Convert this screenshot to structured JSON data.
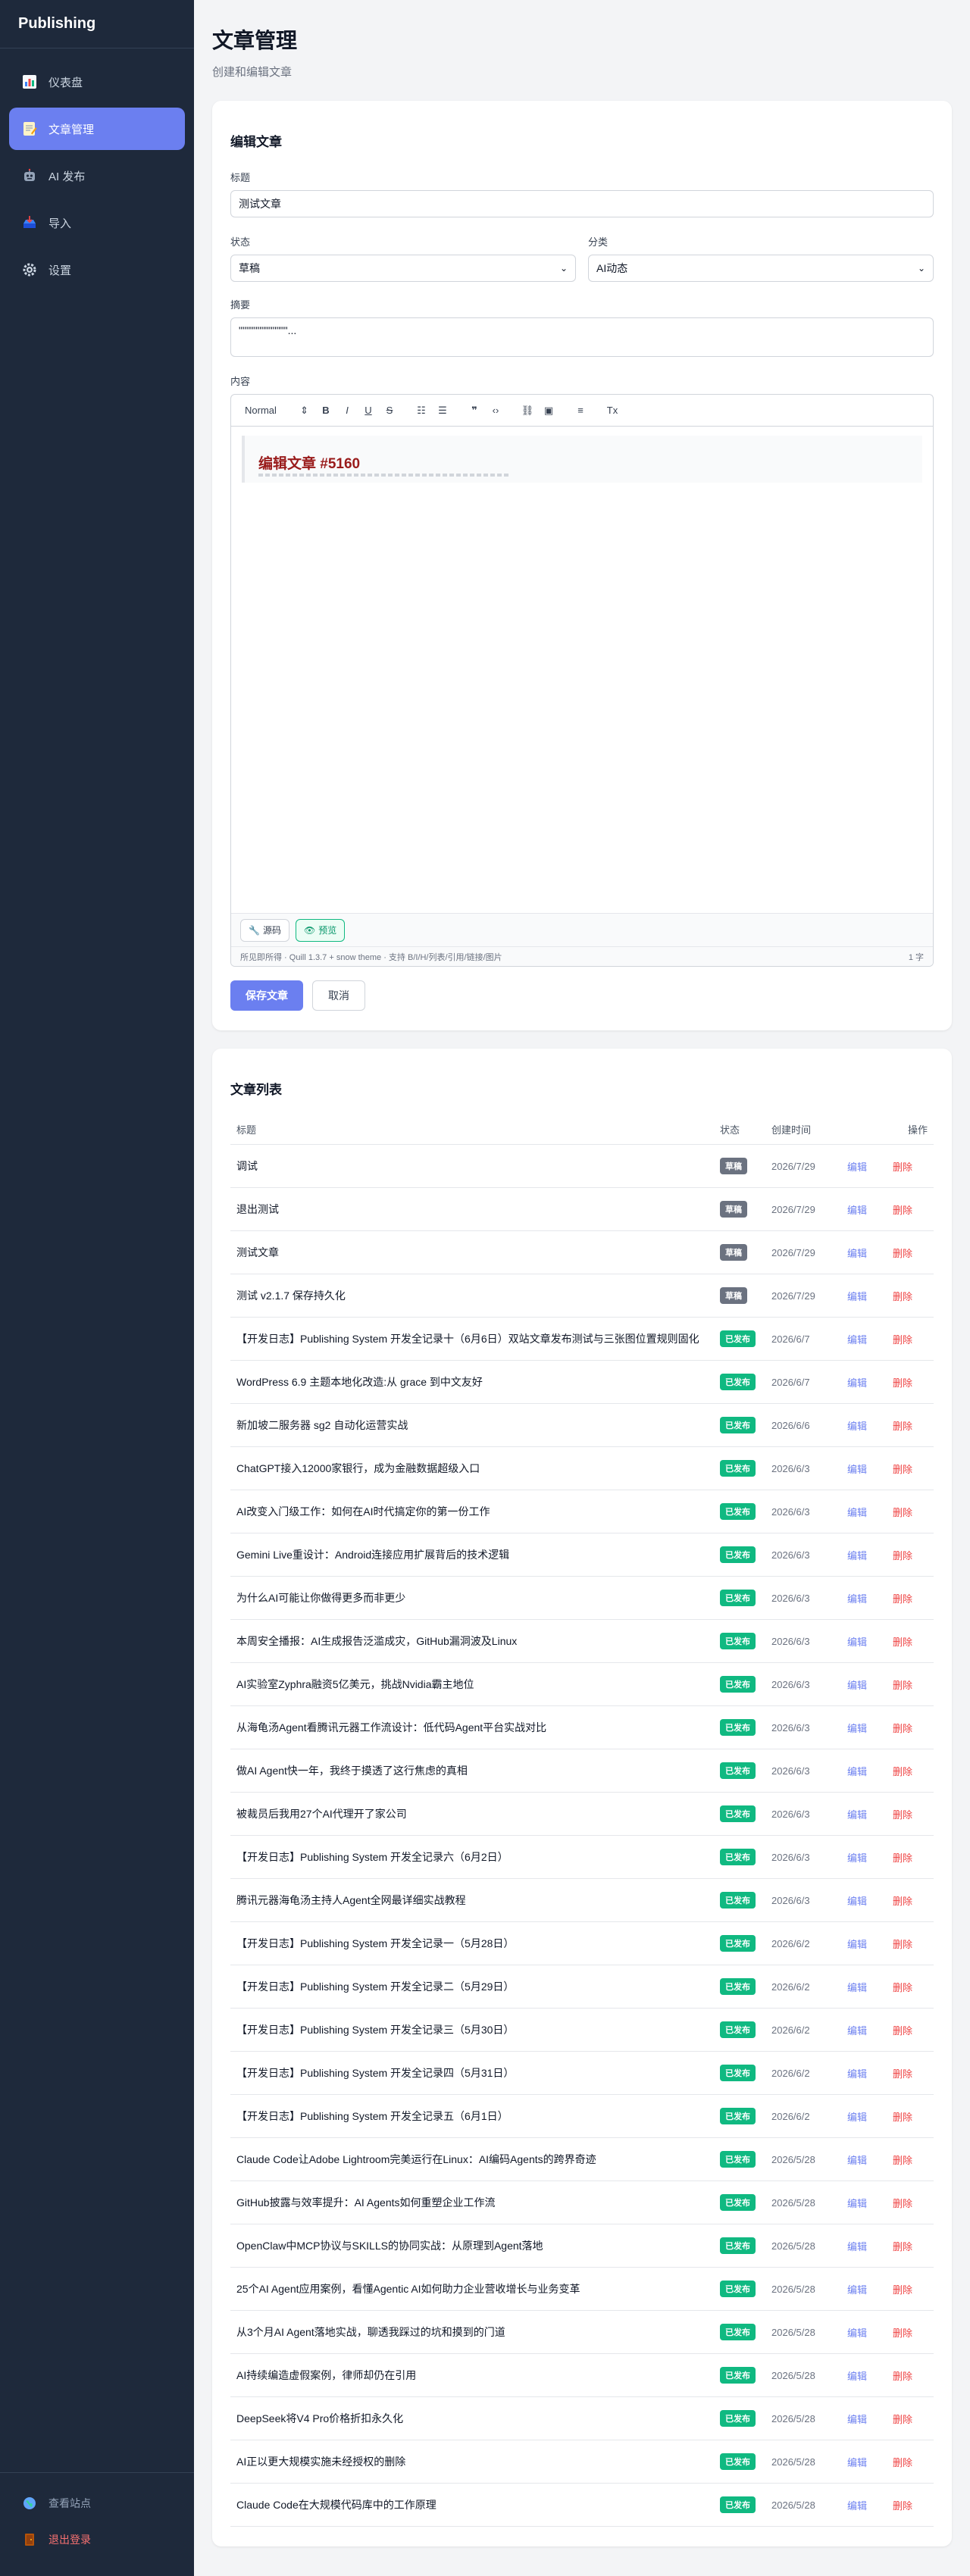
{
  "app": {
    "brand": "Publishing"
  },
  "sidebar": {
    "items": [
      {
        "label": "仪表盘",
        "icon": "bar-chart-icon"
      },
      {
        "label": "文章管理",
        "icon": "memo-icon"
      },
      {
        "label": "AI 发布",
        "icon": "robot-icon"
      },
      {
        "label": "导入",
        "icon": "inbox-icon"
      },
      {
        "label": "设置",
        "icon": "gear-icon"
      }
    ],
    "active": "文章管理",
    "footer": {
      "view_site": "查看站点",
      "logout": "退出登录"
    }
  },
  "header": {
    "title": "文章管理",
    "subtitle": "创建和编辑文章"
  },
  "editor": {
    "card_title": "编辑文章",
    "title_label": "标题",
    "title_value": "测试文章",
    "status_label": "状态",
    "status_value": "草稿",
    "category_label": "分类",
    "category_value": "AI动态",
    "summary_label": "摘要",
    "summary_value": "\"\"\"\"\"\"\"\"\"\"\"\"\"...",
    "content_label": "内容",
    "toolbar_format": "Normal",
    "preview_title": "编辑文章 #5160",
    "source_button": "源码",
    "preview_button": "预览",
    "status_info": "所见即所得 · Quill 1.3.7 + snow theme · 支持 B/I/H/列表/引用/链接/图片",
    "char_count": "1 字",
    "save_button": "保存文章",
    "cancel_button": "取消"
  },
  "articles": {
    "card_title": "文章列表",
    "columns": {
      "title": "标题",
      "status": "状态",
      "created": "创建时间",
      "actions": "操作"
    },
    "edit_label": "编辑",
    "delete_label": "删除",
    "rows": [
      {
        "title": "调试",
        "status": "草稿",
        "date": "2026/7/29"
      },
      {
        "title": "退出测试",
        "status": "草稿",
        "date": "2026/7/29"
      },
      {
        "title": "测试文章",
        "status": "草稿",
        "date": "2026/7/29"
      },
      {
        "title": "测试 v2.1.7 保存持久化",
        "status": "草稿",
        "date": "2026/7/29"
      },
      {
        "title": "【开发日志】Publishing System 开发全记录十（6月6日）双站文章发布测试与三张图位置规则固化",
        "status": "已发布",
        "date": "2026/6/7"
      },
      {
        "title": "WordPress 6.9 主题本地化改造:从 grace 到中文友好",
        "status": "已发布",
        "date": "2026/6/7"
      },
      {
        "title": "新加坡二服务器 sg2 自动化运营实战",
        "status": "已发布",
        "date": "2026/6/6"
      },
      {
        "title": "ChatGPT接入12000家银行，成为金融数据超级入口",
        "status": "已发布",
        "date": "2026/6/3"
      },
      {
        "title": "AI改变入门级工作：如何在AI时代搞定你的第一份工作",
        "status": "已发布",
        "date": "2026/6/3"
      },
      {
        "title": "Gemini Live重设计：Android连接应用扩展背后的技术逻辑",
        "status": "已发布",
        "date": "2026/6/3"
      },
      {
        "title": "为什么AI可能让你做得更多而非更少",
        "status": "已发布",
        "date": "2026/6/3"
      },
      {
        "title": "本周安全播报：AI生成报告泛滥成灾，GitHub漏洞波及Linux",
        "status": "已发布",
        "date": "2026/6/3"
      },
      {
        "title": "AI实验室Zyphra融资5亿美元，挑战Nvidia霸主地位",
        "status": "已发布",
        "date": "2026/6/3"
      },
      {
        "title": "从海龟汤Agent看腾讯元器工作流设计：低代码Agent平台实战对比",
        "status": "已发布",
        "date": "2026/6/3"
      },
      {
        "title": "做AI Agent快一年，我终于摸透了这行焦虑的真相",
        "status": "已发布",
        "date": "2026/6/3"
      },
      {
        "title": "被裁员后我用27个AI代理开了家公司",
        "status": "已发布",
        "date": "2026/6/3"
      },
      {
        "title": "【开发日志】Publishing System 开发全记录六（6月2日）",
        "status": "已发布",
        "date": "2026/6/3"
      },
      {
        "title": "腾讯元器海龟汤主持人Agent全网最详细实战教程",
        "status": "已发布",
        "date": "2026/6/3"
      },
      {
        "title": "【开发日志】Publishing System 开发全记录一（5月28日）",
        "status": "已发布",
        "date": "2026/6/2"
      },
      {
        "title": "【开发日志】Publishing System 开发全记录二（5月29日）",
        "status": "已发布",
        "date": "2026/6/2"
      },
      {
        "title": "【开发日志】Publishing System 开发全记录三（5月30日）",
        "status": "已发布",
        "date": "2026/6/2"
      },
      {
        "title": "【开发日志】Publishing System 开发全记录四（5月31日）",
        "status": "已发布",
        "date": "2026/6/2"
      },
      {
        "title": "【开发日志】Publishing System 开发全记录五（6月1日）",
        "status": "已发布",
        "date": "2026/6/2"
      },
      {
        "title": "Claude Code让Adobe Lightroom完美运行在Linux：AI编码Agents的跨界奇迹",
        "status": "已发布",
        "date": "2026/5/28"
      },
      {
        "title": "GitHub披露与效率提升：AI Agents如何重塑企业工作流",
        "status": "已发布",
        "date": "2026/5/28"
      },
      {
        "title": "OpenClaw中MCP协议与SKILLS的协同实战：从原理到Agent落地",
        "status": "已发布",
        "date": "2026/5/28"
      },
      {
        "title": "25个AI Agent应用案例，看懂Agentic AI如何助力企业营收增长与业务变革",
        "status": "已发布",
        "date": "2026/5/28"
      },
      {
        "title": "从3个月AI Agent落地实战，聊透我踩过的坑和摸到的门道",
        "status": "已发布",
        "date": "2026/5/28"
      },
      {
        "title": "AI持续编造虚假案例，律师却仍在引用",
        "status": "已发布",
        "date": "2026/5/28"
      },
      {
        "title": "DeepSeek将V4 Pro价格折扣永久化",
        "status": "已发布",
        "date": "2026/5/28"
      },
      {
        "title": "AI正以更大规模实施未经授权的删除",
        "status": "已发布",
        "date": "2026/5/28"
      },
      {
        "title": "Claude Code在大规模代码库中的工作原理",
        "status": "已发布",
        "date": "2026/5/28"
      }
    ]
  },
  "colors": {
    "accent": "#6b7ff0",
    "sidebar_bg": "#1e293b",
    "published": "#10b981",
    "draft": "#6b7280",
    "danger": "#ef4444"
  }
}
